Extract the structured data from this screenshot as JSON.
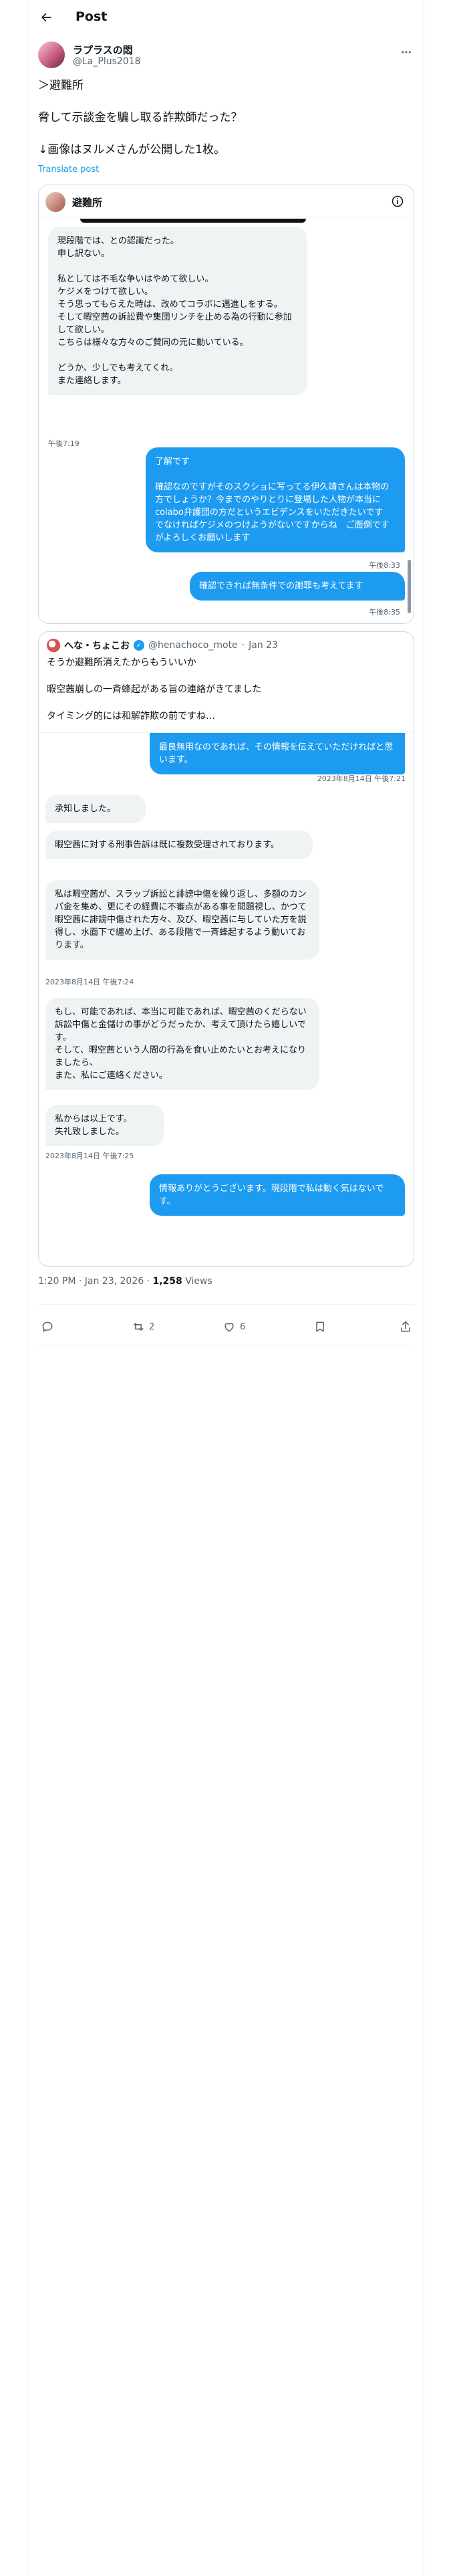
{
  "header": {
    "title": "Post"
  },
  "author": {
    "name": "ラプラスの悶",
    "handle": "@La_Plus2018"
  },
  "tweet": {
    "text": "＞避難所\n\n脅して示談金を騙し取る詐欺師だった？\n\n↓画像はヌルメさんが公開した1枚。",
    "translate": "Translate post"
  },
  "media_chat": {
    "title": "避難所",
    "messages": [
      {
        "side": "left",
        "text": "現段階では、との認識だった。\n申し訳ない。\n\n私としては不毛な争いはやめて欲しい。\nケジメをつけて欲しい。\nそう思ってもらえた時は、改めてコラボに邁進しをする。\nそして暇空茜の訴訟費や集団リンチを止める為の行動に参加して欲しい。\nこちらは様々な方々のご賛同の元に動いている。\n\nどうか、少しでも考えてくれ。\nまた連絡します。"
      },
      {
        "side": "ts-left",
        "text": "午後7:19"
      },
      {
        "side": "right",
        "text": "了解です\n\n確認なのですがそのスクショに写ってる伊久靖さんは本物の方でしょうか？今までのやりとりに登場した人物が本当にcolabo弁護団の方だというエビデンスをいただきたいです　でなければケジメのつけようがないですからね　ご面倒ですがよろしくお願いします"
      },
      {
        "side": "ts-right",
        "text": "午後8:33"
      },
      {
        "side": "right",
        "text": "確認できれば無条件での謝罪も考えてます"
      },
      {
        "side": "ts-right",
        "text": "午後8:35"
      }
    ]
  },
  "quote": {
    "name": "へな・ちょこお",
    "handle": "@henachoco_mote",
    "date": "Jan 23",
    "text": "そうか避難所消えたからもういいか\n\n暇空茜崩しの一斉蜂起がある旨の連絡がきてました\n\nタイミング的には和解詐欺の前ですね…",
    "chat": {
      "messages": [
        {
          "side": "right",
          "text": "最良無用なのであれば、その情報を伝えていただければと思います。"
        },
        {
          "side": "ts-right",
          "text": "2023年8月14日 午後7:21"
        },
        {
          "side": "left",
          "text": "承知しました。"
        },
        {
          "side": "left",
          "text": "暇空茜に対する刑事告訴は既に複数受理されております。"
        },
        {
          "side": "left",
          "text": "私は暇空茜が、スラップ訴訟と誹謗中傷を繰り返し、多額のカンパ金を集め、更にその経費に不審点がある事を問題視し、かつて暇空茜に誹謗中傷された方々、及び、暇空茜に与していた方を説得し、水面下で纏め上げ、ある段階で一斉蜂起するよう動いております。"
        },
        {
          "side": "ts-left",
          "text": "2023年8月14日 午後7:24"
        },
        {
          "side": "left",
          "text": "もし、可能であれば、本当に可能であれば、暇空茜のくだらない訴訟中傷と金儲けの事がどうだったか、考えて頂けたら嬉しいです。\nそして、暇空茜という人間の行為を食い止めたいとお考えになりましたら、\nまた、私にご連絡ください。"
        },
        {
          "side": "left",
          "text": "私からは以上です。\n失礼致しました。"
        },
        {
          "side": "ts-left",
          "text": "2023年8月14日 午後7:25"
        },
        {
          "side": "right",
          "text": "情報ありがとうございます。現段階で私は動く気はないです。"
        }
      ]
    }
  },
  "meta": {
    "time": "1:20 PM · Jan 23, 2026",
    "views_count": "1,258",
    "views_label": "Views"
  },
  "actions": {
    "reply_count": "",
    "repost_count": "2",
    "like_count": "6"
  }
}
